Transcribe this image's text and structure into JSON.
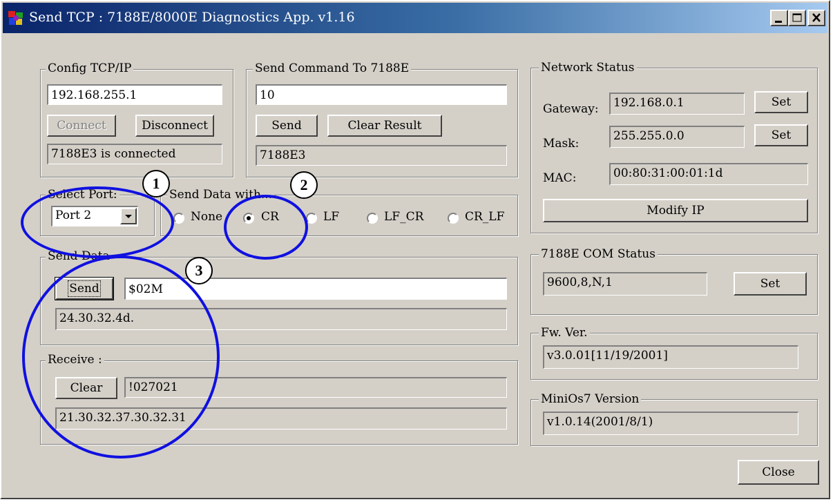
{
  "window": {
    "title": "Send TCP : 7188E/8000E Diagnostics App. v1.16",
    "icon": "app-logo-icon",
    "controls": [
      "minimize-icon",
      "maximize-icon",
      "close-icon"
    ]
  },
  "config": {
    "legend": "Config TCP/IP",
    "ip": "192.168.255.1",
    "connect_label": "Connect",
    "disconnect_label": "Disconnect",
    "status": "7188E3 is connected"
  },
  "send_command": {
    "legend": "Send Command To 7188E",
    "command": "10",
    "send_label": "Send",
    "clear_label": "Clear Result",
    "result": "7188E3"
  },
  "select_port": {
    "legend": "Select Port:",
    "value": "Port 2"
  },
  "send_data_with": {
    "legend": "Send Data with...",
    "options": [
      "None",
      "CR",
      "LF",
      "LF_CR",
      "CR_LF"
    ],
    "selected": "CR"
  },
  "send_data": {
    "legend": "Send Data",
    "send_label": "Send",
    "value": "$02M",
    "hex": "24.30.32.4d."
  },
  "receive": {
    "legend": "Receive :",
    "clear_label": "Clear",
    "value": "!027021",
    "hex": "21.30.32.37.30.32.31"
  },
  "network": {
    "legend": "Network Status",
    "gateway_label": "Gateway:",
    "gateway": "192.168.0.1",
    "mask_label": "Mask:",
    "mask": "255.255.0.0",
    "mac_label": "MAC:",
    "mac": "00:80:31:00:01:1d",
    "set_label": "Set",
    "modify_label": "Modify IP"
  },
  "com_status": {
    "legend": "7188E COM Status",
    "value": "9600,8,N,1",
    "set_label": "Set"
  },
  "fw": {
    "legend": "Fw. Ver.",
    "value": "v3.0.01[11/19/2001]"
  },
  "minios": {
    "legend": "MiniOs7 Version",
    "value": "v1.0.14(2001/8/1)"
  },
  "close_label": "Close",
  "annotations": [
    "1",
    "2",
    "3"
  ],
  "colors": {
    "annotation": "#1010e0",
    "face": "#d4d0c8",
    "title_start": "#0a246a",
    "title_end": "#a6caf0"
  }
}
